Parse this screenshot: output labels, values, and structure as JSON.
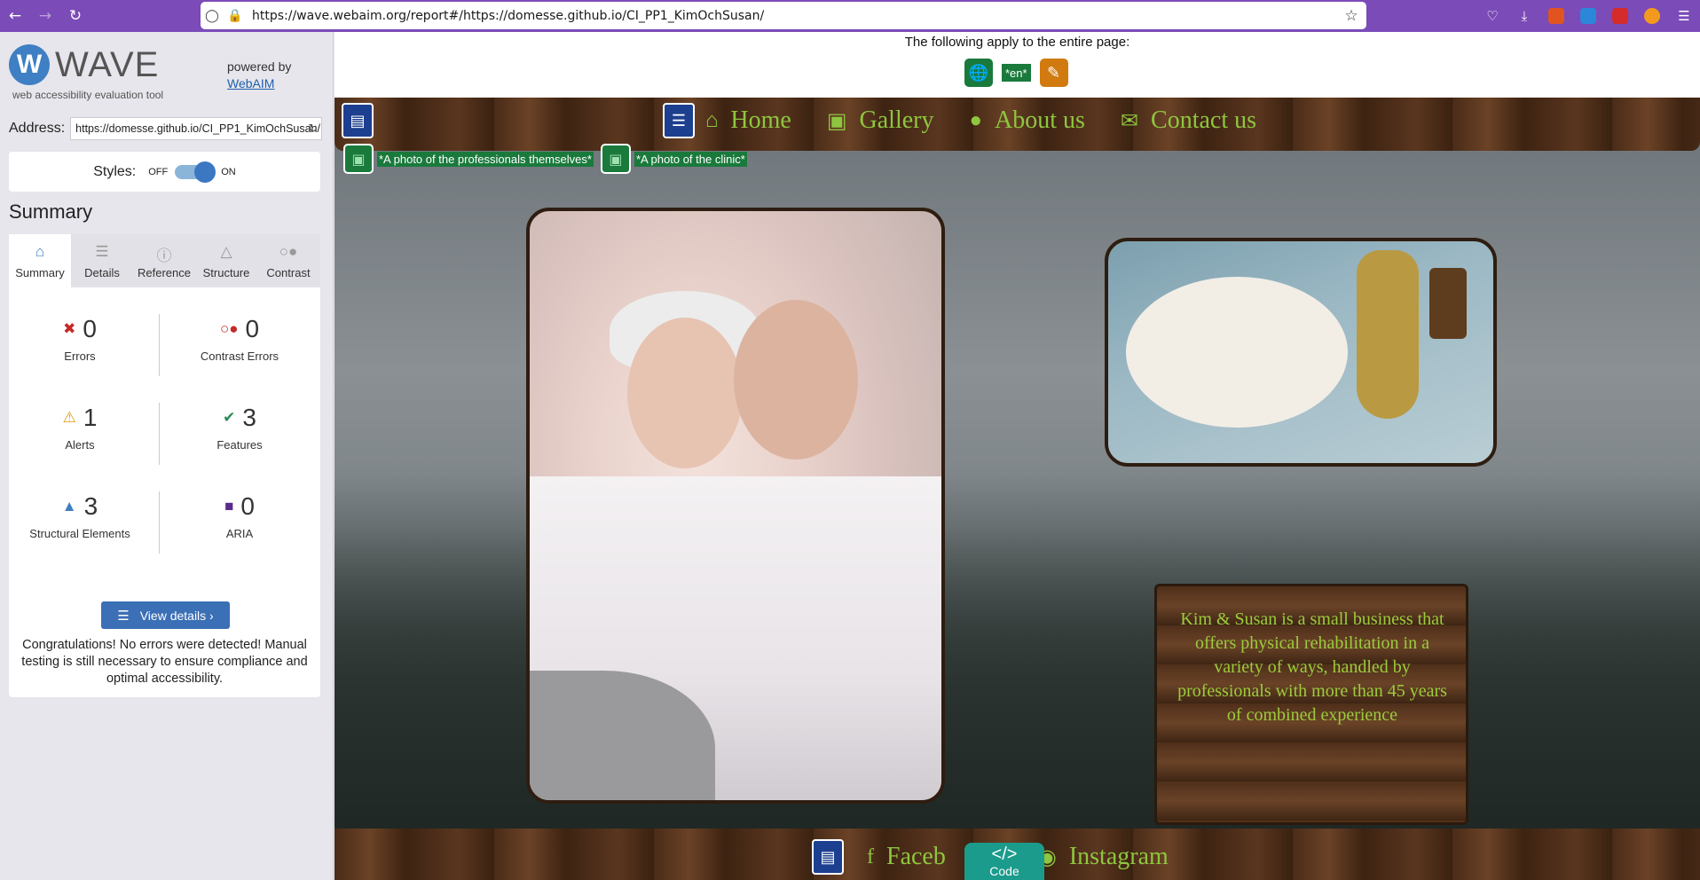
{
  "browser": {
    "url": "https://wave.webaim.org/report#/https://domesse.github.io/CI_PP1_KimOchSusan/",
    "back_icon": "arrow-left",
    "forward_icon": "arrow-right",
    "reload_icon": "reload",
    "bookmark_icon": "star"
  },
  "wave": {
    "logo_letter": "W",
    "brand": "WAVE",
    "tagline": "web accessibility evaluation tool",
    "powered_by": "powered by",
    "powered_link": "WebAIM",
    "address_label": "Address:",
    "address_value": "https://domesse.github.io/CI_PP1_KimOchSusan/",
    "styles_label": "Styles:",
    "styles_off": "OFF",
    "styles_on": "ON",
    "styles_enabled": true,
    "summary_title": "Summary",
    "tabs": [
      {
        "label": "Summary",
        "icon": "home-icon",
        "active": true
      },
      {
        "label": "Details",
        "icon": "list-icon",
        "active": false
      },
      {
        "label": "Reference",
        "icon": "info-icon",
        "active": false
      },
      {
        "label": "Structure",
        "icon": "structure-icon",
        "active": false
      },
      {
        "label": "Contrast",
        "icon": "contrast-icon",
        "active": false
      }
    ],
    "stats": {
      "errors": {
        "value": "0",
        "label": "Errors",
        "color": "#c62828"
      },
      "contrast_errors": {
        "value": "0",
        "label": "Contrast Errors",
        "color": "#c62828"
      },
      "alerts": {
        "value": "1",
        "label": "Alerts",
        "color": "#e09a1a"
      },
      "features": {
        "value": "3",
        "label": "Features",
        "color": "#2e8b57"
      },
      "structural": {
        "value": "3",
        "label": "Structural Elements",
        "color": "#3f7fc4"
      },
      "aria": {
        "value": "0",
        "label": "ARIA",
        "color": "#5b2b8c"
      }
    },
    "view_details": "View details ›",
    "congrats": "Congratulations! No errors were detected! Manual testing is still necessary to ensure compliance and optimal accessibility."
  },
  "report": {
    "apply_text": "The following apply to the entire page:",
    "lang_badge": "*en*",
    "nav": [
      {
        "label": "Home",
        "icon": "home-icon"
      },
      {
        "label": "Gallery",
        "icon": "image-icon"
      },
      {
        "label": "About us",
        "icon": "user-icon"
      },
      {
        "label": "Contact us",
        "icon": "envelope-icon"
      }
    ],
    "alt_texts": [
      "*A photo of the professionals themselves*",
      "*A photo of the clinic*"
    ],
    "about_text": "Kim & Susan is a small business that offers physical rehabilitation in a variety of ways, handled by professionals with more than 45 years of combined experience",
    "footer": [
      {
        "label": "Faceb",
        "icon": "facebook-icon"
      },
      {
        "label": "Instagram",
        "icon": "instagram-icon"
      }
    ],
    "code_tab_label": "Code",
    "code_tab_icon": "</>"
  },
  "colors": {
    "browser_accent": "#7b4bb8",
    "wave_blue": "#3b6fb6",
    "site_green": "#8ec63f",
    "wave_feature_green": "#1a7a3c"
  }
}
